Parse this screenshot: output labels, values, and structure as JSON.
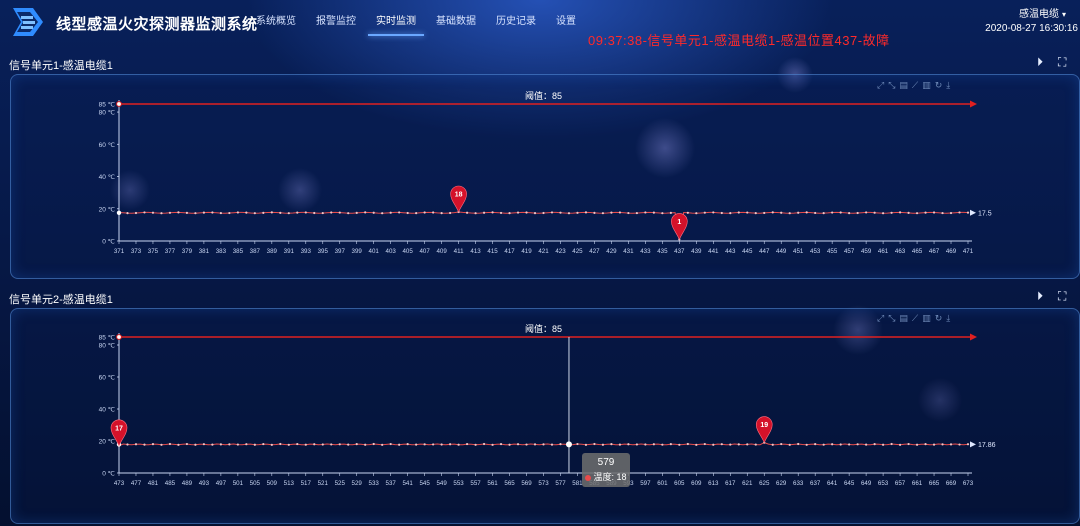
{
  "header": {
    "title": "线型感温火灾探测器监测系统",
    "nav": [
      "系统概览",
      "报警监控",
      "实时监测",
      "基础数据",
      "历史记录",
      "设置"
    ],
    "active_index": 2,
    "alarm_text": "09:37:38-信号单元1-感温电缆1-感温位置437-故障",
    "user": "感温电缆",
    "datetime": "2020-08-27 16:30:16"
  },
  "icons": {
    "logo": "app-logo-icon",
    "play": "play-circle-icon",
    "fullscreen": "fullscreen-icon",
    "toolbox": [
      "zoom-icon",
      "zoom-reset-icon",
      "data-view-icon",
      "line-chart-icon",
      "bar-chart-icon",
      "restore-icon",
      "download-icon"
    ]
  },
  "colors": {
    "series": "#e84b4b",
    "threshold": "#e02020",
    "alarm": "#ff2a2a",
    "accent": "#6aa8ff"
  },
  "panels": [
    {
      "title": "信号单元1-感温电缆1",
      "threshold_label": "阈值：85",
      "end_label": "17.5"
    },
    {
      "title": "信号单元2-感温电缆1",
      "threshold_label": "阈值：85",
      "end_label": "17.86",
      "tooltip": {
        "x": "579",
        "label": "温度: 18"
      }
    }
  ],
  "chart_data": [
    {
      "type": "line",
      "title": "信号单元1-感温电缆1",
      "xlabel": "",
      "ylabel": "",
      "x_range": [
        371,
        471
      ],
      "x_tick_labels": [
        "371",
        "373",
        "375",
        "377",
        "379",
        "381",
        "383",
        "385",
        "387",
        "389",
        "391",
        "393",
        "395",
        "397",
        "399",
        "401",
        "403",
        "405",
        "407",
        "409",
        "411",
        "413",
        "415",
        "417",
        "419",
        "421",
        "423",
        "425",
        "427",
        "429",
        "431",
        "433",
        "435",
        "437",
        "439",
        "441",
        "443",
        "445",
        "447",
        "449",
        "451",
        "453",
        "455",
        "457",
        "459",
        "461",
        "463",
        "465",
        "467",
        "469",
        "471"
      ],
      "y_tick_labels": [
        "0 ℃",
        "20 ℃",
        "40 ℃",
        "60 ℃",
        "80 ℃",
        "85 ℃"
      ],
      "ylim": [
        0,
        85
      ],
      "series": [
        {
          "base": 17.5,
          "markers": [
            {
              "x": 411,
              "y": 18,
              "label": "18"
            },
            {
              "x": 437,
              "y": 1,
              "label": "1"
            }
          ]
        }
      ],
      "threshold": {
        "value": 85,
        "label": "阈值：85"
      },
      "end_value": 17.5
    },
    {
      "type": "line",
      "title": "信号单元2-感温电缆1",
      "xlabel": "",
      "ylabel": "",
      "x_range": [
        473,
        673
      ],
      "x_tick_labels": [
        "473",
        "477",
        "481",
        "485",
        "489",
        "493",
        "497",
        "501",
        "505",
        "509",
        "513",
        "517",
        "521",
        "525",
        "529",
        "533",
        "537",
        "541",
        "545",
        "549",
        "553",
        "557",
        "561",
        "565",
        "569",
        "573",
        "577",
        "581",
        "585",
        "589",
        "593",
        "597",
        "601",
        "605",
        "609",
        "613",
        "617",
        "621",
        "625",
        "629",
        "633",
        "637",
        "641",
        "645",
        "649",
        "653",
        "657",
        "661",
        "665",
        "669",
        "673"
      ],
      "y_tick_labels": [
        "0 ℃",
        "20 ℃",
        "40 ℃",
        "60 ℃",
        "80 ℃",
        "85 ℃"
      ],
      "ylim": [
        0,
        85
      ],
      "series": [
        {
          "base": 17.86,
          "markers": [
            {
              "x": 473,
              "y": 17,
              "label": "17"
            },
            {
              "x": 625,
              "y": 19,
              "label": "19"
            }
          ]
        }
      ],
      "threshold": {
        "value": 85,
        "label": "阈值：85"
      },
      "end_value": 17.86,
      "cursor_x": 579
    }
  ]
}
